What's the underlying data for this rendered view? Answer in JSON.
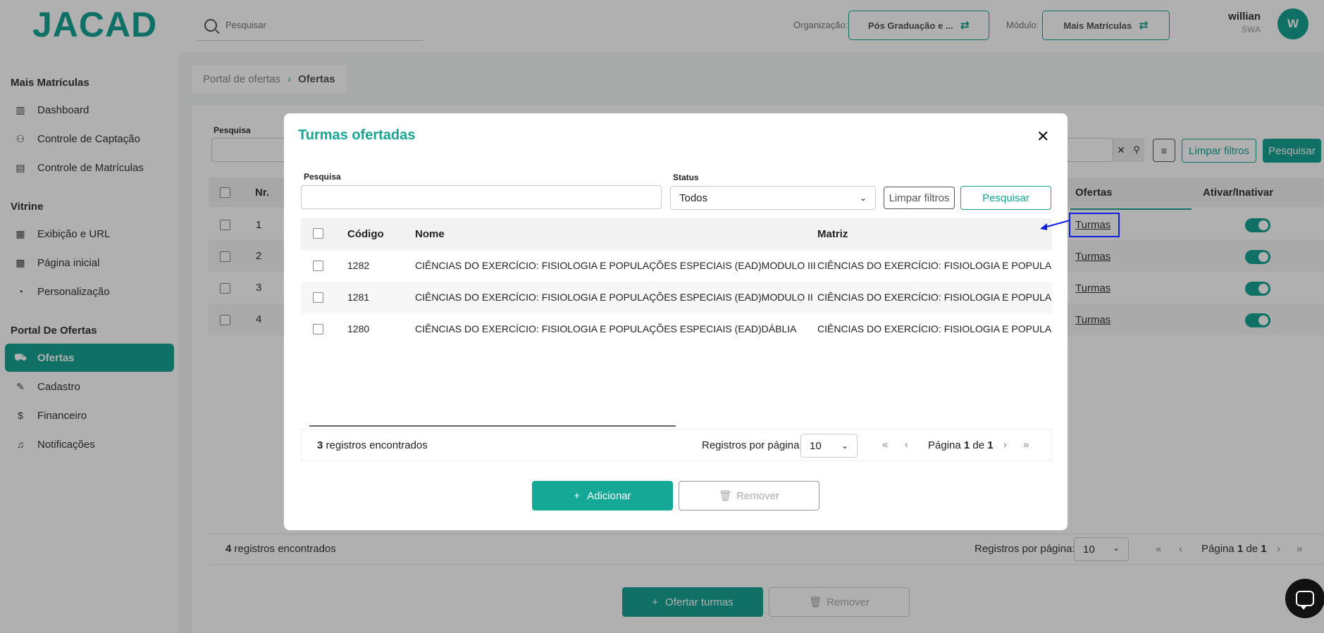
{
  "header": {
    "logo": "JACAD",
    "search_placeholder": "Pesquisar",
    "org_label": "Organização:",
    "org_value": "Pós Graduação e ...",
    "module_label": "Módulo:",
    "module_value": "Mais Matrículas",
    "user_name": "willian",
    "user_sub": "SWA",
    "avatar_initial": "W"
  },
  "sidebar": {
    "sections": [
      {
        "title": "Mais Matrículas",
        "items": [
          "Dashboard",
          "Controle de Captação",
          "Controle de Matrículas"
        ]
      },
      {
        "title": "Vitrine",
        "items": [
          "Exibição e URL",
          "Página inicial",
          "Personalização"
        ]
      },
      {
        "title": "Portal De Ofertas",
        "items": [
          "Ofertas",
          "Cadastro",
          "Financeiro",
          "Notificações"
        ]
      }
    ],
    "active": "Ofertas"
  },
  "breadcrumb": {
    "parent": "Portal de ofertas",
    "current": "Ofertas"
  },
  "page": {
    "search_label": "Pesquisa",
    "clear_filters": "Limpar filtros",
    "search_button": "Pesquisar",
    "col_nr": "Nr.",
    "col_ofertas": "Ofertas",
    "col_ativar": "Ativar/Inativar",
    "rows": [
      {
        "nr": "1",
        "link": "Turmas"
      },
      {
        "nr": "2",
        "link": "Turmas"
      },
      {
        "nr": "3",
        "link": "Turmas"
      },
      {
        "nr": "4",
        "link": "Turmas"
      }
    ],
    "count_num": "4",
    "count_text": " registros encontrados",
    "rpp_label": "Registros por página:",
    "rpp_value": "10",
    "page_label": "Página ",
    "page_num": "1",
    "page_of": " de ",
    "page_total": "1",
    "ofertar_button": "Ofertar turmas",
    "remover_button": "Remover"
  },
  "modal": {
    "title": "Turmas ofertadas",
    "search_label": "Pesquisa",
    "status_label": "Status",
    "status_value": "Todos",
    "clear_filters": "Limpar filtros",
    "search_button": "Pesquisar",
    "columns": {
      "codigo": "Código",
      "nome": "Nome",
      "matriz": "Matriz"
    },
    "rows": [
      {
        "codigo": "1282",
        "nome": "CIÊNCIAS DO EXERCÍCIO: FISIOLOGIA E POPULAÇÕES ESPECIAIS (EAD)MODULO III",
        "matriz": "CIÊNCIAS DO EXERCÍCIO: FISIOLOGIA E POPULAÇÕE"
      },
      {
        "codigo": "1281",
        "nome": "CIÊNCIAS DO EXERCÍCIO: FISIOLOGIA E POPULAÇÕES ESPECIAIS (EAD)MODULO II",
        "matriz": "CIÊNCIAS DO EXERCÍCIO: FISIOLOGIA E POPULAÇÕE"
      },
      {
        "codigo": "1280",
        "nome": "CIÊNCIAS DO EXERCÍCIO: FISIOLOGIA E POPULAÇÕES ESPECIAIS (EAD)DÁBLIA",
        "matriz": "CIÊNCIAS DO EXERCÍCIO: FISIOLOGIA E POPULAÇÕE"
      }
    ],
    "count_num": "3",
    "count_text": " registros encontrados",
    "rpp_label": "Registros por página:",
    "rpp_value": "10",
    "page_label": "Página ",
    "page_num": "1",
    "page_of": " de ",
    "page_total": "1",
    "add_button": "Adicionar",
    "remove_button": "Remover"
  },
  "colors": {
    "accent": "#17a493",
    "highlight": "#1020e0"
  }
}
